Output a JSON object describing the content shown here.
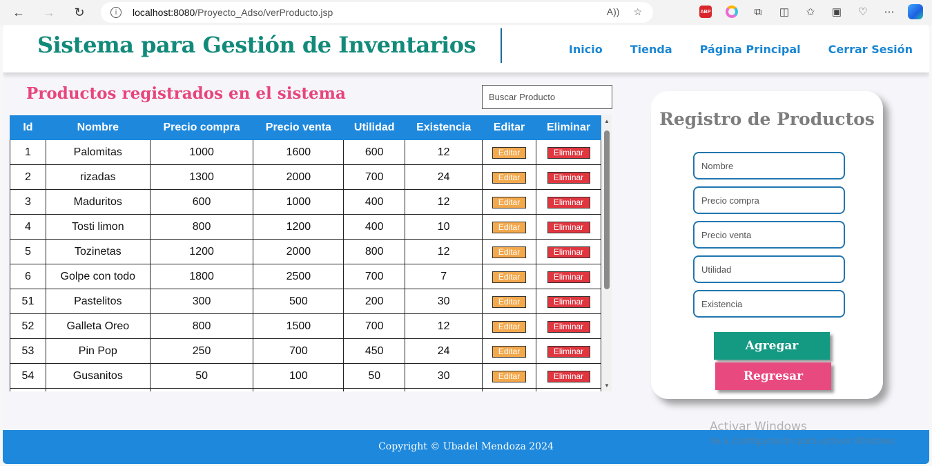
{
  "browser": {
    "url_host": "localhost:8080",
    "url_path": "/Proyecto_Adso/verProducto.jsp"
  },
  "header": {
    "title": "Sistema para Gestión de Inventarios",
    "nav": [
      "Inicio",
      "Tienda",
      "Página Principal",
      "Cerrar Sesión"
    ]
  },
  "main": {
    "subtitle": "Productos registrados en el sistema",
    "search_placeholder": "Buscar Producto",
    "columns": [
      "Id",
      "Nombre",
      "Precio compra",
      "Precio venta",
      "Utilidad",
      "Existencia",
      "Editar",
      "Eliminar"
    ],
    "edit_label": "Editar",
    "delete_label": "Eliminar",
    "rows": [
      [
        "1",
        "Palomitas",
        "1000",
        "1600",
        "600",
        "12"
      ],
      [
        "2",
        "rizadas",
        "1300",
        "2000",
        "700",
        "24"
      ],
      [
        "3",
        "Maduritos",
        "600",
        "1000",
        "400",
        "12"
      ],
      [
        "4",
        "Tosti limon",
        "800",
        "1200",
        "400",
        "10"
      ],
      [
        "5",
        "Tozinetas",
        "1200",
        "2000",
        "800",
        "12"
      ],
      [
        "6",
        "Golpe con todo",
        "1800",
        "2500",
        "700",
        "7"
      ],
      [
        "51",
        "Pastelitos",
        "300",
        "500",
        "200",
        "30"
      ],
      [
        "52",
        "Galleta Oreo",
        "800",
        "1500",
        "700",
        "12"
      ],
      [
        "53",
        "Pin Pop",
        "250",
        "700",
        "450",
        "24"
      ],
      [
        "54",
        "Gusanitos",
        "50",
        "100",
        "50",
        "30"
      ],
      [
        "",
        "",
        "",
        "",
        "",
        ""
      ]
    ]
  },
  "form": {
    "title": "Registro de Productos",
    "placeholders": [
      "Nombre",
      "Precio compra",
      "Precio venta",
      "Utilidad",
      "Existencia"
    ],
    "add_label": "Agregar",
    "back_label": "Regresar"
  },
  "footer": {
    "text": "Copyright © Ubadel Mendoza 2024"
  },
  "watermark": {
    "line1": "Activar Windows",
    "line2": "Ve a Configuración para activar Windows."
  },
  "colors": {
    "brand": "#128a7a",
    "accent_blue": "#1e88dc",
    "pink": "#e8457c",
    "edit": "#f3a84b",
    "delete": "#e0363f"
  }
}
